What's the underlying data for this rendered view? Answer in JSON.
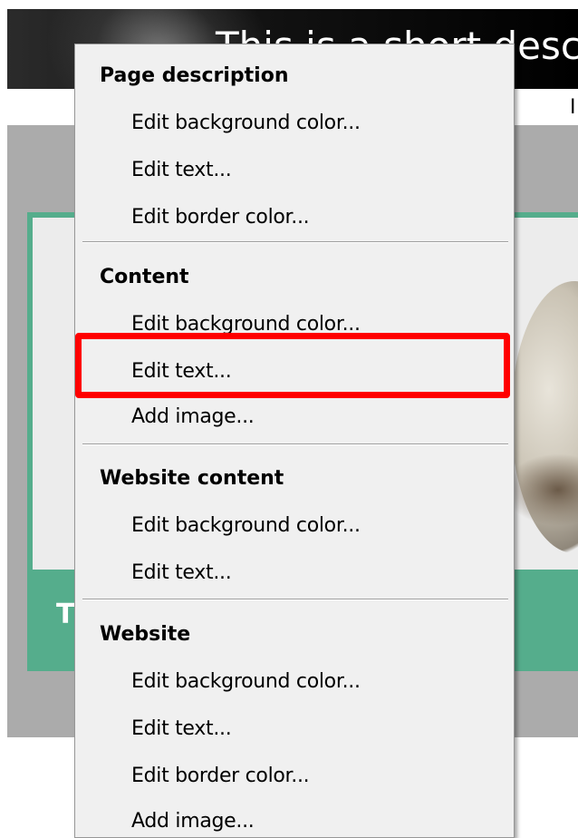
{
  "site": {
    "header_title": "This is a short descri",
    "page_description_text": "I",
    "content_caption": "T"
  },
  "menu": {
    "groups": [
      {
        "header": "Page description",
        "items": [
          "Edit background color...",
          "Edit text...",
          "Edit border color..."
        ]
      },
      {
        "header": "Content",
        "items": [
          "Edit background color...",
          "Edit text...",
          "Add image..."
        ]
      },
      {
        "header": "Website content",
        "items": [
          "Edit background color...",
          "Edit text..."
        ]
      },
      {
        "header": "Website",
        "items": [
          "Edit background color...",
          "Edit text...",
          "Edit border color...",
          "Add image..."
        ]
      }
    ],
    "highlighted_item": "Content > Edit text..."
  },
  "colors": {
    "menu_background": "#f0f0f0",
    "highlight_border": "#ff0000",
    "content_panel": "#55ad8c",
    "content_area": "#ababab",
    "header_background": "#000000"
  }
}
